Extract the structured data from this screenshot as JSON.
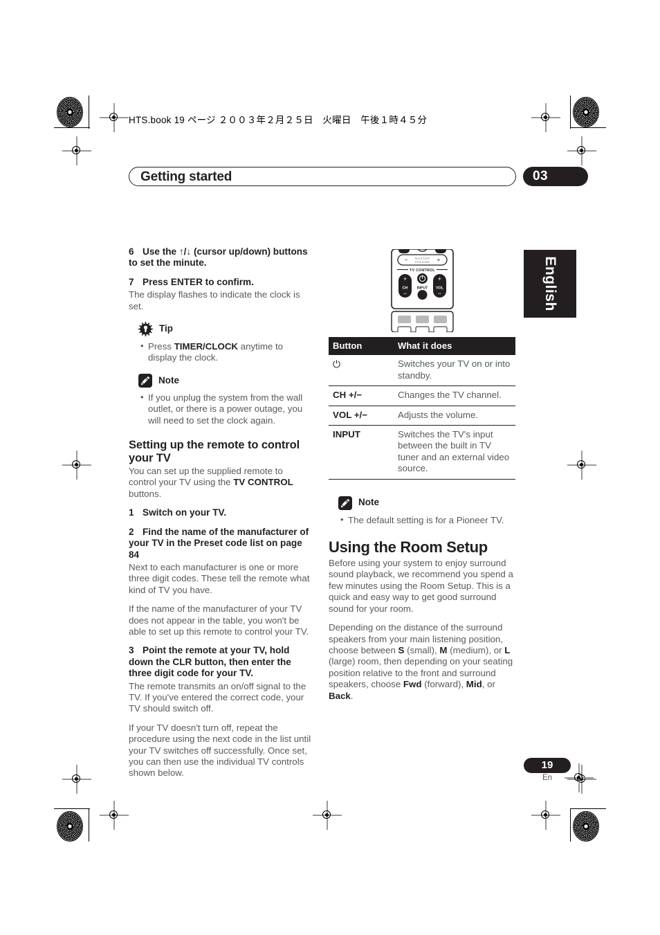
{
  "running_head": "HTS.book  19 ページ  ２００３年２月２５日　火曜日　午後１時４５分",
  "chapter": {
    "title": "Getting started",
    "number": "03"
  },
  "language_tab": "English",
  "footer": {
    "page_number": "19",
    "language_code": "En"
  },
  "colors": {
    "ink": "#231f20",
    "body_text": "#58595b",
    "paper": "#ffffff"
  },
  "left_column": {
    "step6": {
      "number": "6",
      "text": "Use the ↑/↓ (cursor up/down) buttons to set the minute."
    },
    "step7": {
      "number": "7",
      "text": "Press ENTER to confirm.",
      "body": "The display flashes to indicate the clock is set."
    },
    "tip": {
      "label": "Tip",
      "icon": "gear-icon",
      "bullets": [
        {
          "pre": "Press ",
          "bold": "TIMER/CLOCK",
          "post": " anytime to display the clock."
        }
      ]
    },
    "note": {
      "label": "Note",
      "icon": "pencil-icon",
      "bullets": [
        {
          "pre": "If you unplug the system from the wall outlet, or there is a power outage, you will need to set the clock again.",
          "bold": "",
          "post": ""
        }
      ]
    },
    "remote_section": {
      "heading": "Setting up the remote to control your TV",
      "intro_pre": "You can set up the supplied remote to control your TV using the ",
      "intro_bold": "TV CONTROL",
      "intro_post": " buttons.",
      "step1": {
        "number": "1",
        "text": "Switch on your TV."
      },
      "step2": {
        "number": "2",
        "text": "Find the name of the manufacturer of your TV in the Preset code list on page 84",
        "body1": "Next to each manufacturer is one or more three digit codes. These tell the remote what kind of TV you have.",
        "body2": "If the name of the manufacturer of your TV does not appear in the table, you won't be able to set up this remote to control your TV."
      },
      "step3": {
        "number": "3",
        "text": "Point the remote at your TV, hold down the CLR button, then enter the three digit code for your TV.",
        "body1": "The remote transmits an on/off signal to the TV. If you've entered the correct code, your TV should switch off.",
        "body2": "If your TV doesn't turn off, repeat the procedure using the next code in the list until your TV switches off successfully. Once set, you can then use the individual TV controls shown below."
      }
    }
  },
  "right_column": {
    "remote_illustration": {
      "master_volume_label": "MASTER VOLUME",
      "tv_control_label": "TV CONTROL",
      "buttons": [
        "CH",
        "INPUT",
        "VOL"
      ],
      "plus": "+",
      "minus": "−"
    },
    "table": {
      "headers": [
        "Button",
        "What it does"
      ],
      "rows": [
        {
          "button": "⏻",
          "button_is_symbol": true,
          "does": "Switches your TV on or into standby."
        },
        {
          "button": "CH +/−",
          "button_is_symbol": false,
          "does": "Changes the TV channel."
        },
        {
          "button": "VOL +/−",
          "button_is_symbol": false,
          "does": "Adjusts the volume."
        },
        {
          "button": "INPUT",
          "button_is_symbol": false,
          "does": "Switches the TV's input between the built in TV tuner and an external video source."
        }
      ]
    },
    "note": {
      "label": "Note",
      "icon": "pencil-icon",
      "bullets": [
        "The default setting is for a Pioneer TV."
      ]
    },
    "room_setup": {
      "heading": "Using the Room Setup",
      "para1": "Before using your system to enjoy surround sound playback, we recommend you spend a few minutes using the Room Setup. This is a quick and easy way to get good surround sound for your room.",
      "para2_p1": "Depending on the distance of the surround speakers from your main listening position, choose between ",
      "para2_b1": "S",
      "para2_p2": " (small), ",
      "para2_b2": "M",
      "para2_p3": " (medium), or ",
      "para2_b3": "L",
      "para2_p4": " (large) room, then depending on your seating position relative to the front and surround speakers, choose ",
      "para2_b4": "Fwd",
      "para2_p5": " (forward), ",
      "para2_b5": "Mid",
      "para2_p6": ", or ",
      "para2_b6": "Back",
      "para2_p7": "."
    }
  }
}
